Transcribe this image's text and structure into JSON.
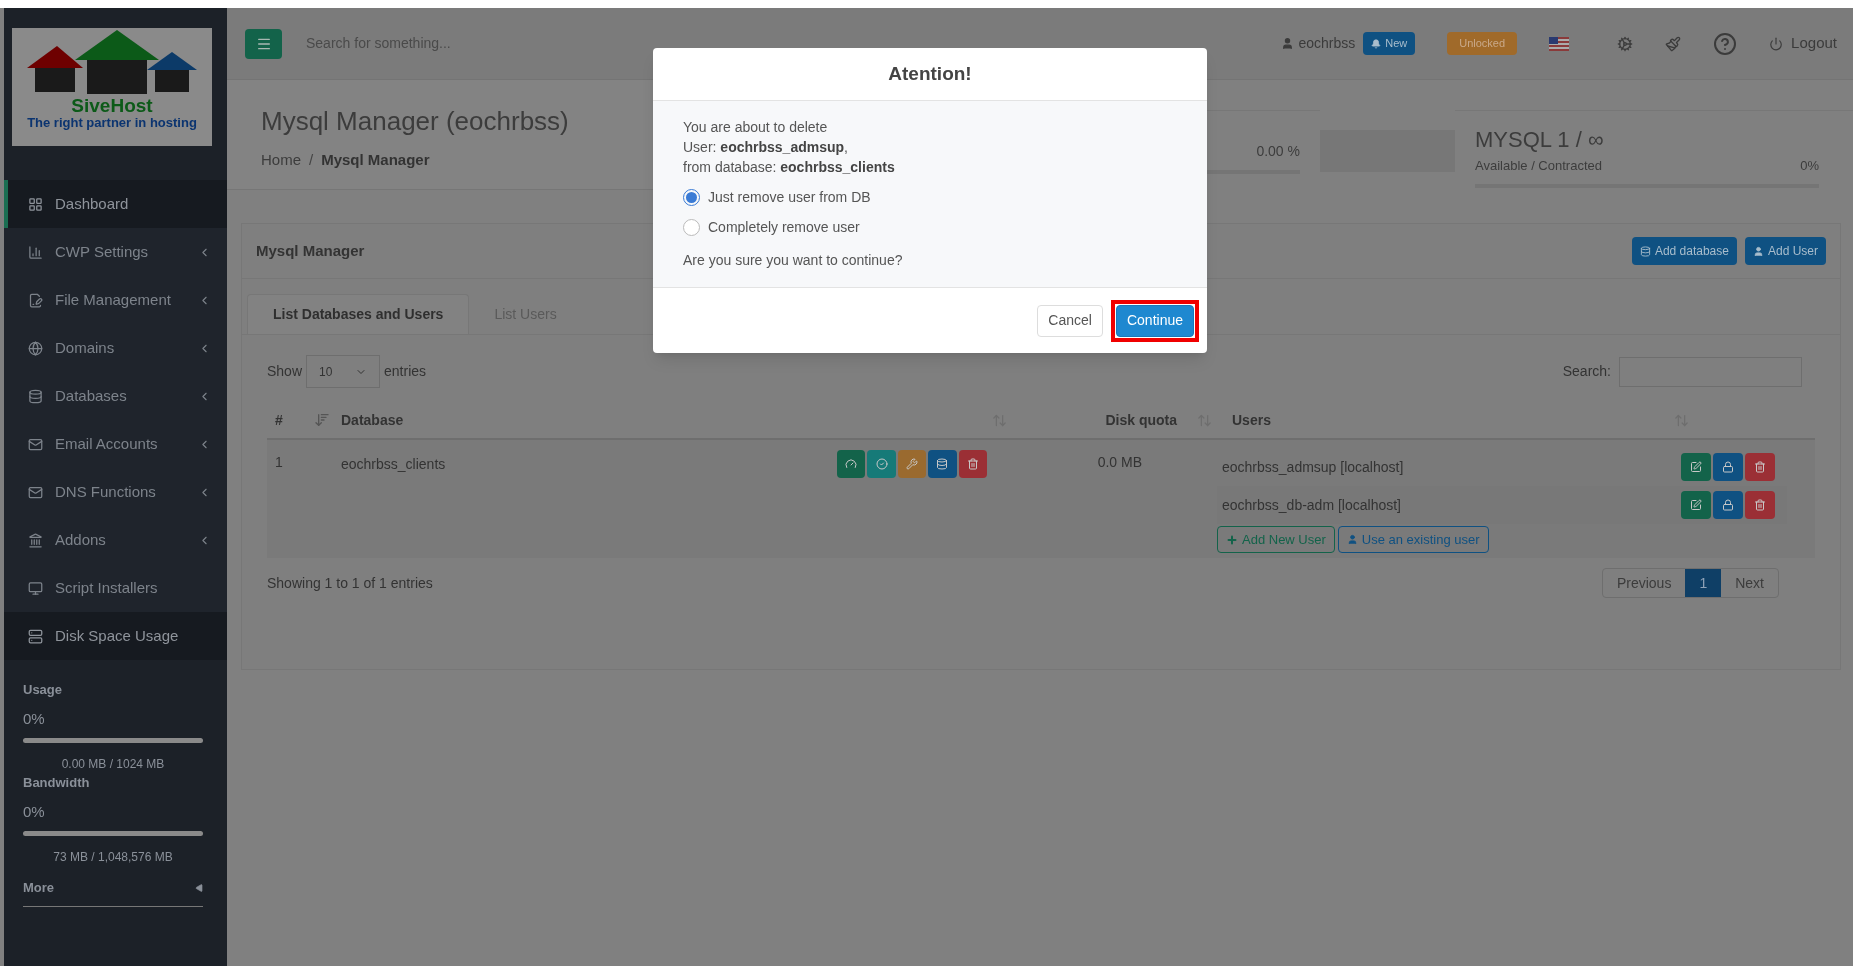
{
  "sidebar": {
    "logo": {
      "name": "SiveHost",
      "tagline": "The right partner in hosting"
    },
    "items": [
      {
        "label": "Dashboard",
        "selected": true,
        "has_submenu": false
      },
      {
        "label": "CWP Settings",
        "selected": false,
        "has_submenu": true
      },
      {
        "label": "File Management",
        "selected": false,
        "has_submenu": true
      },
      {
        "label": "Domains",
        "selected": false,
        "has_submenu": true
      },
      {
        "label": "Databases",
        "selected": false,
        "has_submenu": true
      },
      {
        "label": "Email Accounts",
        "selected": false,
        "has_submenu": true
      },
      {
        "label": "DNS Functions",
        "selected": false,
        "has_submenu": true
      },
      {
        "label": "Addons",
        "selected": false,
        "has_submenu": true
      },
      {
        "label": "Script Installers",
        "selected": false,
        "has_submenu": false
      },
      {
        "label": "Disk Space Usage",
        "selected": true,
        "has_submenu": false
      }
    ],
    "meters": [
      {
        "label": "Usage",
        "percent": "0%",
        "level": 0,
        "detail": "0.00 MB / 1024 MB"
      },
      {
        "label": "Bandwidth",
        "percent": "0%",
        "level": 0,
        "detail": "73 MB / 1,048,576 MB"
      }
    ],
    "more": "More"
  },
  "topbar": {
    "search_placeholder": "Search for something...",
    "user": "eochrbss",
    "new_badge": "New",
    "unlocked_badge": "Unlocked",
    "logout": "Logout"
  },
  "page": {
    "title": "Mysql Manager (eochrbss)",
    "breadcrumb": [
      "Home",
      "Mysql Manager"
    ],
    "breadcrumb_separator": "/"
  },
  "stats": [
    {
      "percent": "0.00 %",
      "level": 0
    },
    {
      "title": "MYSQL 1 / ∞",
      "subtitle": "Available / Contracted",
      "percent": "0%",
      "level": 0
    }
  ],
  "panel": {
    "title": "Mysql Manager",
    "buttons": [
      "Add database",
      "Add User"
    ],
    "tabs": [
      {
        "label": "List Databases and Users",
        "selected": true
      },
      {
        "label": "List Users",
        "selected": false
      }
    ],
    "show": "Show",
    "entries_select": "10",
    "entries": "entries",
    "search_label": "Search:",
    "columns": [
      "#",
      "Database",
      "Disk quota",
      "Users"
    ],
    "rows": [
      {
        "number": "1",
        "database": "eochrbss_clients",
        "disk_quota": "0.0 MB",
        "users": [
          "eochrbss_admsup [localhost]",
          "eochrbss_db-adm [localhost]"
        ]
      }
    ],
    "add_new_user": "Add New User",
    "use_existing": "Use an existing user",
    "info": "Showing 1 to 1 of 1 entries",
    "pagination": [
      {
        "label": "Previous",
        "selected": false
      },
      {
        "label": "1",
        "selected": true
      },
      {
        "label": "Next",
        "selected": false
      }
    ]
  },
  "modal": {
    "title": "Atention!",
    "lines": [
      "You are about to delete",
      "User: **eochrbss_admsup**,",
      "from database: **eochrbss_clients**"
    ],
    "options": [
      {
        "label": "Just remove user from DB",
        "selected": true
      },
      {
        "label": "Completely remove user",
        "selected": false
      }
    ],
    "question": "Are you sure you want to continue?",
    "buttons": [
      {
        "label": "Cancel",
        "kind": "default",
        "highlighted": false
      },
      {
        "label": "Continue",
        "kind": "primary",
        "highlighted": true
      }
    ]
  }
}
